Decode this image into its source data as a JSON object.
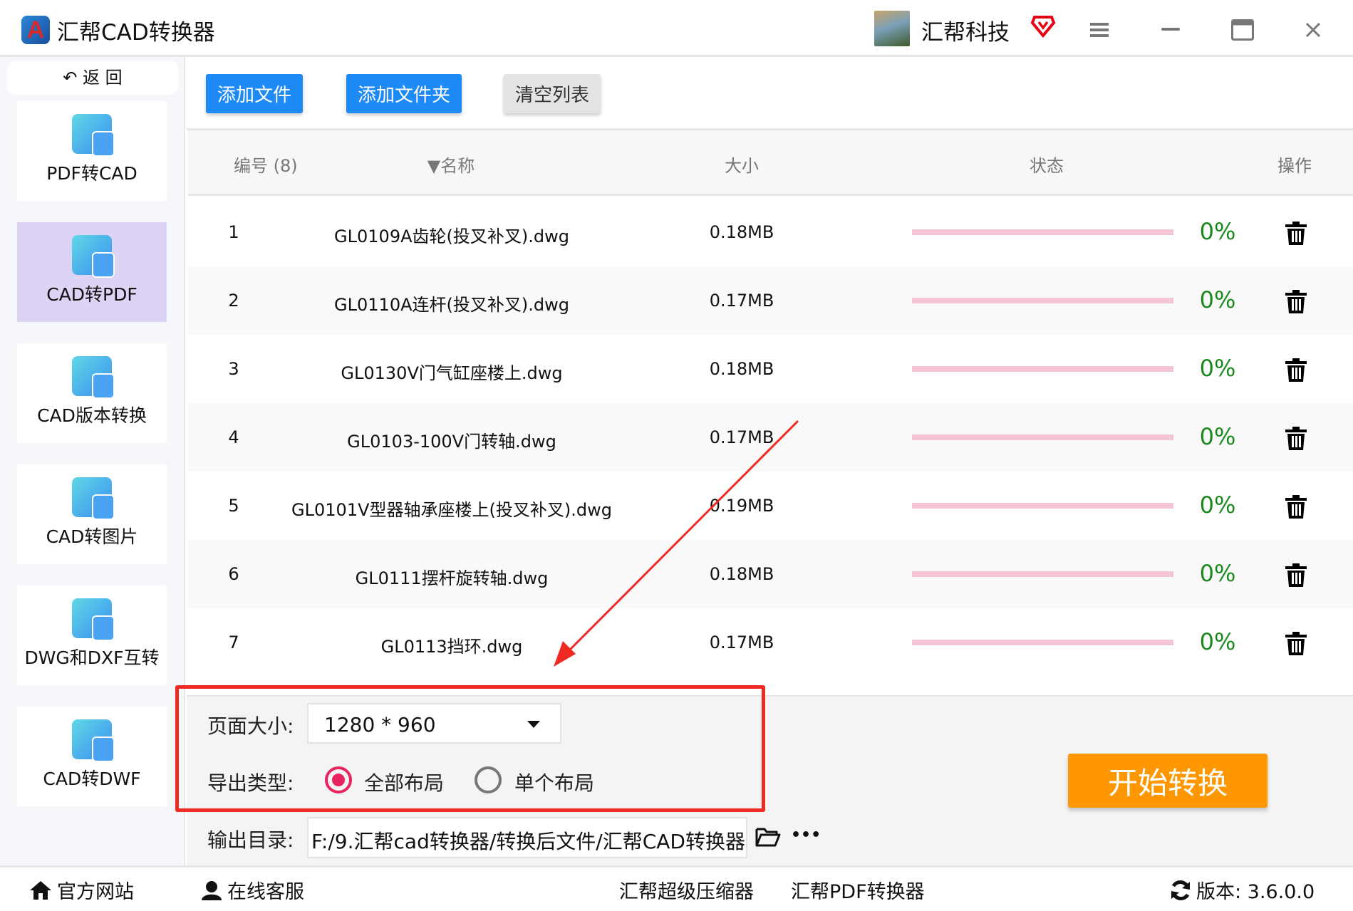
{
  "app": {
    "title": "汇帮CAD转换器",
    "brand": "汇帮科技"
  },
  "sidebar": {
    "back_label": "返 回",
    "items": [
      {
        "label": "PDF转CAD",
        "active": false
      },
      {
        "label": "CAD转PDF",
        "active": true
      },
      {
        "label": "CAD版本转换",
        "active": false
      },
      {
        "label": "CAD转图片",
        "active": false
      },
      {
        "label": "DWG和DXF互转",
        "active": false
      },
      {
        "label": "CAD转DWF",
        "active": false
      }
    ]
  },
  "toolbar": {
    "add_file": "添加文件",
    "add_folder": "添加文件夹",
    "clear_list": "清空列表"
  },
  "table": {
    "headers": {
      "index": "编号 (8)",
      "name": "名称",
      "size": "大小",
      "status": "状态",
      "action": "操作"
    },
    "rows": [
      {
        "index": "1",
        "name": "GL0109A齿轮(投叉补叉).dwg",
        "size": "0.18MB",
        "progress": "0%"
      },
      {
        "index": "2",
        "name": "GL0110A连杆(投叉补叉).dwg",
        "size": "0.17MB",
        "progress": "0%"
      },
      {
        "index": "3",
        "name": "GL0130V门气缸座楼上.dwg",
        "size": "0.18MB",
        "progress": "0%"
      },
      {
        "index": "4",
        "name": "GL0103-100V门转轴.dwg",
        "size": "0.17MB",
        "progress": "0%"
      },
      {
        "index": "5",
        "name": "GL0101V型器轴承座楼上(投叉补叉).dwg",
        "size": "0.19MB",
        "progress": "0%"
      },
      {
        "index": "6",
        "name": "GL0111摆杆旋转轴.dwg",
        "size": "0.18MB",
        "progress": "0%"
      },
      {
        "index": "7",
        "name": "GL0113挡环.dwg",
        "size": "0.17MB",
        "progress": "0%"
      }
    ]
  },
  "settings": {
    "page_size_label": "页面大小:",
    "page_size_value": "1280 * 960",
    "export_type_label": "导出类型:",
    "export_all": "全部布局",
    "export_single": "单个布局",
    "selected_export": "all",
    "output_dir_label": "输出目录:",
    "output_dir_value": "F:/9.汇帮cad转换器/转换后文件/汇帮CAD转换器",
    "more": "•••"
  },
  "start_label": "开始转换",
  "footer": {
    "website": "官方网站",
    "support": "在线客服",
    "compressor": "汇帮超级压缩器",
    "pdf_converter": "汇帮PDF转换器",
    "version": "版本:  3.6.0.0"
  },
  "colors": {
    "accent": "#1e8af5",
    "start": "#ff9800",
    "progress_track": "#f5c5d5",
    "percent": "#1b8a1b",
    "annotation": "#ef2a22"
  }
}
